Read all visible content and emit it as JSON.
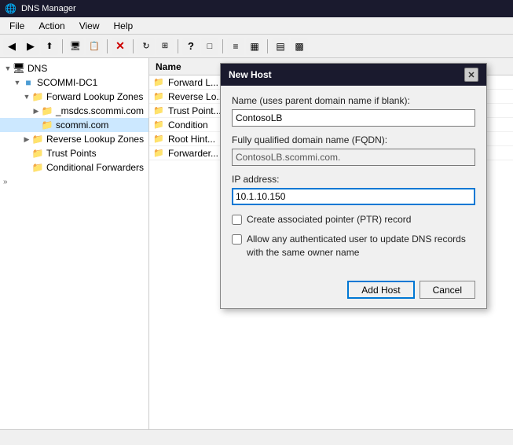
{
  "titleBar": {
    "label": "DNS Manager",
    "icon": "dns-manager-icon"
  },
  "menuBar": {
    "items": [
      "File",
      "Action",
      "View",
      "Help"
    ]
  },
  "toolbar": {
    "buttons": [
      {
        "id": "back",
        "icon": "◀",
        "label": "Back"
      },
      {
        "id": "forward",
        "icon": "▶",
        "label": "Forward"
      },
      {
        "id": "up",
        "icon": "⬆",
        "label": "Up"
      },
      {
        "id": "show-hide",
        "icon": "🖥",
        "label": "Show/Hide"
      },
      {
        "id": "export",
        "icon": "📋",
        "label": "Export"
      },
      {
        "id": "sep1",
        "type": "sep"
      },
      {
        "id": "delete",
        "icon": "✕",
        "label": "Delete"
      },
      {
        "id": "sep2",
        "type": "sep"
      },
      {
        "id": "refresh",
        "icon": "🔄",
        "label": "Refresh"
      },
      {
        "id": "prop1",
        "icon": "⊞",
        "label": "Properties"
      },
      {
        "id": "sep3",
        "type": "sep"
      },
      {
        "id": "help",
        "icon": "?",
        "label": "Help"
      },
      {
        "id": "connect",
        "icon": "□",
        "label": "Connect"
      },
      {
        "id": "sep4",
        "type": "sep"
      },
      {
        "id": "view1",
        "icon": "≡",
        "label": "List"
      },
      {
        "id": "view2",
        "icon": "▦",
        "label": "Details"
      },
      {
        "id": "sep5",
        "type": "sep"
      },
      {
        "id": "filter1",
        "icon": "▤",
        "label": "Filter"
      },
      {
        "id": "filter2",
        "icon": "▩",
        "label": "Advanced"
      }
    ]
  },
  "sidebar": {
    "items": [
      {
        "id": "dns-root",
        "label": "DNS",
        "level": 0,
        "expanded": true,
        "type": "root",
        "icon": "computer"
      },
      {
        "id": "scommi-dc1",
        "label": "SCOMMI-DC1",
        "level": 1,
        "expanded": true,
        "type": "server",
        "icon": "server"
      },
      {
        "id": "forward-zones",
        "label": "Forward Lookup Zones",
        "level": 2,
        "expanded": true,
        "type": "folder",
        "icon": "folder"
      },
      {
        "id": "msdcs",
        "label": "_msdcs.scommi.com",
        "level": 3,
        "expanded": false,
        "type": "folder",
        "icon": "folder"
      },
      {
        "id": "scommi-com",
        "label": "scommi.com",
        "level": 3,
        "expanded": false,
        "type": "folder",
        "icon": "folder",
        "selected": true
      },
      {
        "id": "reverse-zones",
        "label": "Reverse Lookup Zones",
        "level": 2,
        "expanded": false,
        "type": "folder",
        "icon": "folder"
      },
      {
        "id": "trust-points",
        "label": "Trust Points",
        "level": 2,
        "expanded": false,
        "type": "folder",
        "icon": "folder"
      },
      {
        "id": "conditional-fwd",
        "label": "Conditional Forwarders",
        "level": 2,
        "expanded": false,
        "type": "folder",
        "icon": "folder"
      }
    ]
  },
  "contentHeader": {
    "col1": "Name"
  },
  "contentRows": [
    {
      "id": "row1",
      "label": "Forward L...",
      "icon": "folder"
    },
    {
      "id": "row2",
      "label": "Reverse Lo...",
      "icon": "folder"
    },
    {
      "id": "row3",
      "label": "Trust Point...",
      "icon": "folder"
    },
    {
      "id": "row4",
      "label": "Condition",
      "icon": "folder"
    },
    {
      "id": "row5",
      "label": "Root Hint...",
      "icon": "folder"
    },
    {
      "id": "row6",
      "label": "Forwarder...",
      "icon": "folder"
    }
  ],
  "statusBar": {
    "text": ""
  },
  "scrollLeft": {
    "icon": "»"
  },
  "modal": {
    "title": "New Host",
    "fields": {
      "nameLabel": "Name (uses parent domain name if blank):",
      "nameValue": "ContosoLB",
      "fqdnLabel": "Fully qualified domain name (FQDN):",
      "fqdnValue": "ContosoLB.scommi.com.",
      "ipLabel": "IP address:",
      "ipValue": "10.1.10.150",
      "checkbox1Label": "Create associated pointer (PTR) record",
      "checkbox1Checked": false,
      "checkbox2Label": "Allow any authenticated user to update DNS records with the same owner name",
      "checkbox2Checked": false
    },
    "buttons": {
      "addHost": "Add Host",
      "cancel": "Cancel"
    }
  }
}
